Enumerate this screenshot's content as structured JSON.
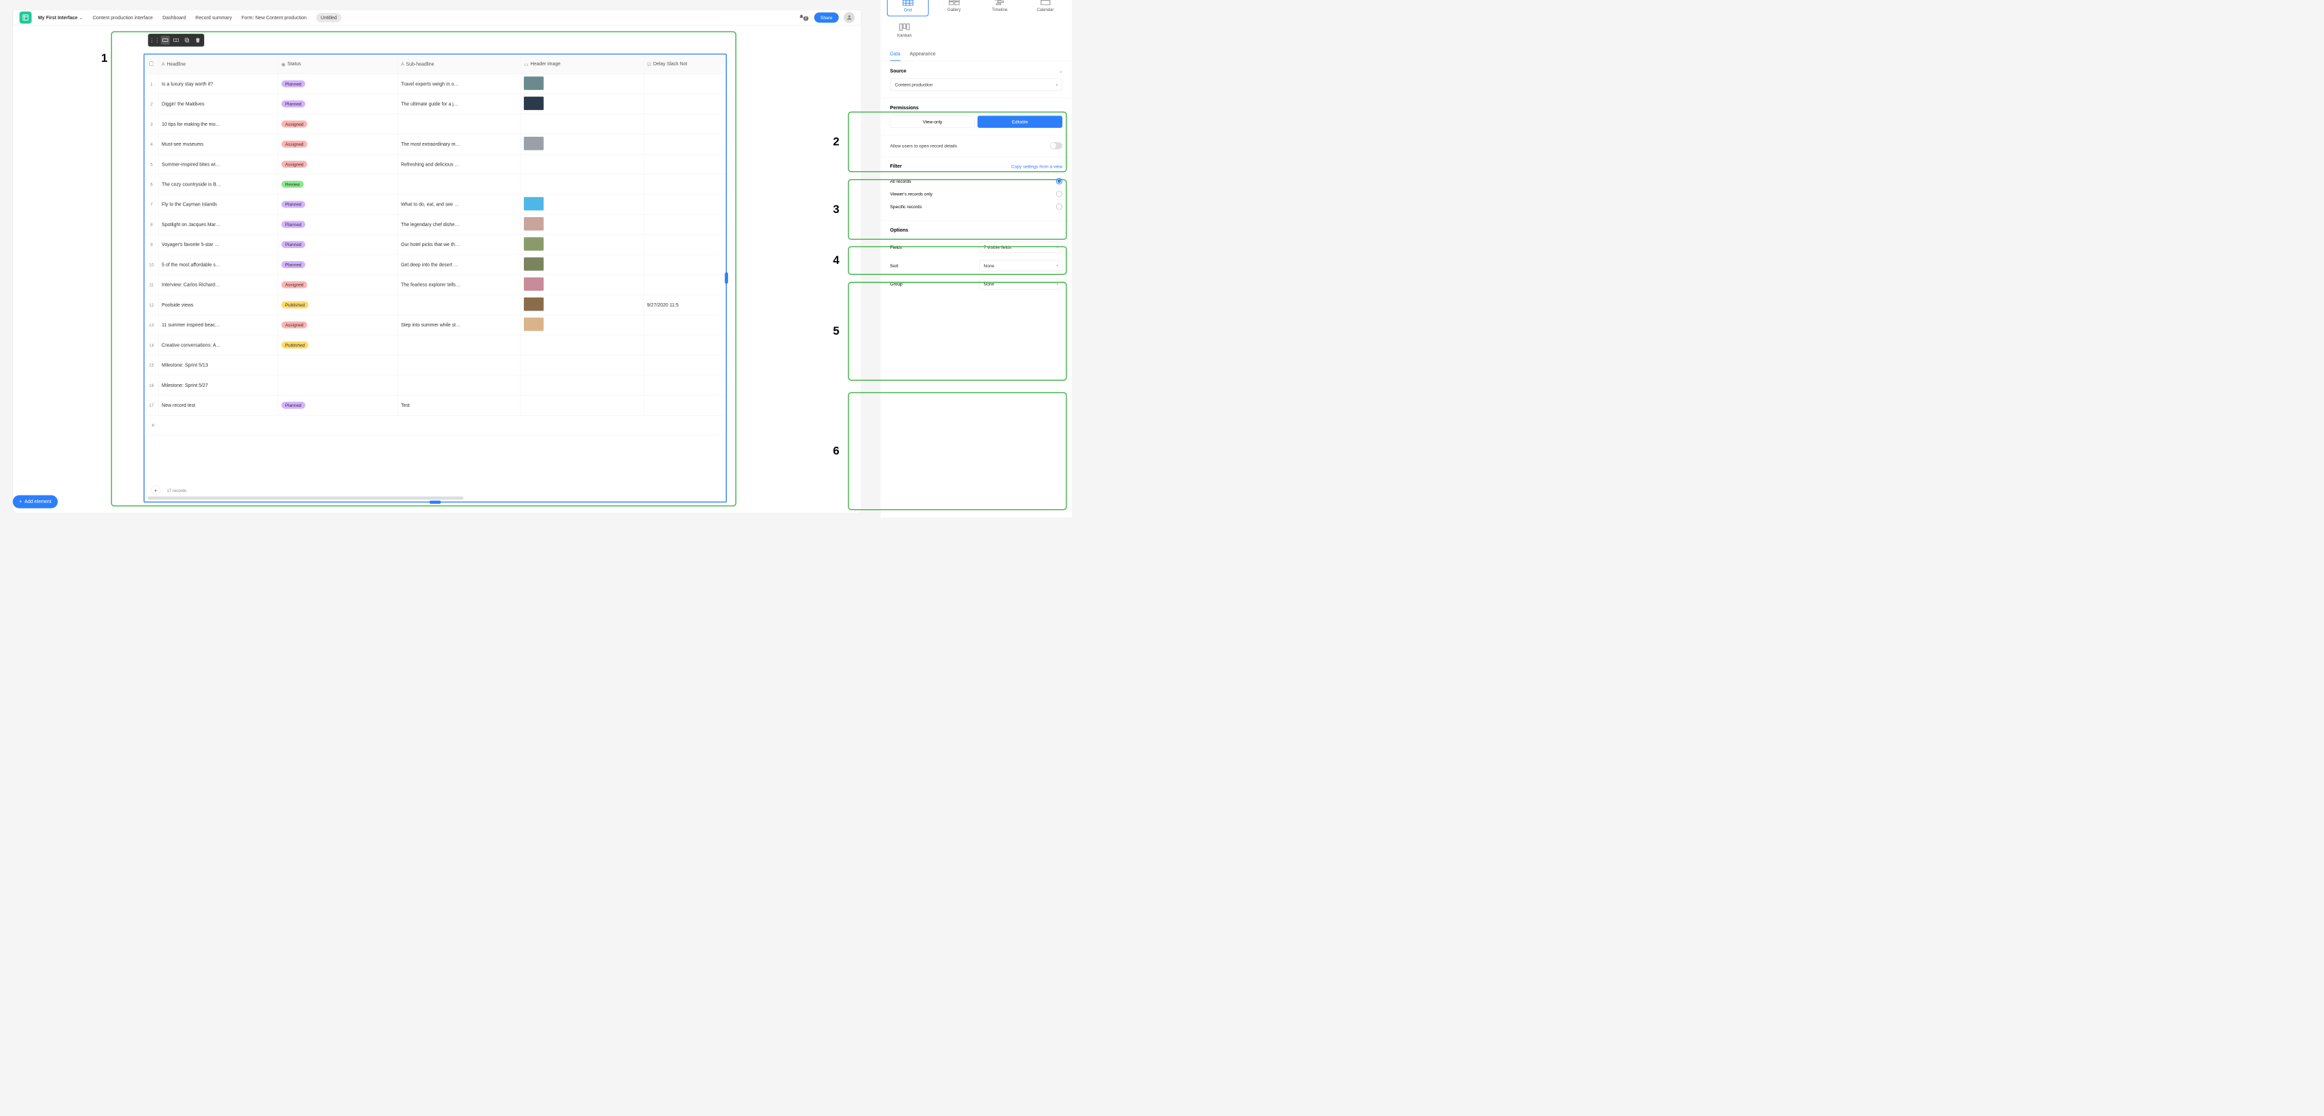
{
  "header": {
    "interface_name": "My First Interface",
    "tabs": [
      "Content production interface",
      "Dashboard",
      "Record summary",
      "Form: New Content production",
      "Untitled"
    ],
    "active_tab_index": 4,
    "notif_count": "8",
    "share_label": "Share"
  },
  "toolbar_callout": "1",
  "grid": {
    "columns": [
      "Headline",
      "Status",
      "Sub-headline",
      "Header image",
      "Delay Slack Not"
    ],
    "rows": [
      {
        "n": "1",
        "headline": "Is a luxury stay worth it?",
        "status": "Planned",
        "sub": "Travel experts weigh in o…",
        "img": "#6b8a8e",
        "delay": ""
      },
      {
        "n": "2",
        "headline": "Diggin' the Maldives",
        "status": "Planned",
        "sub": "The ultimate guide for a j…",
        "img": "#2b3a4a",
        "delay": ""
      },
      {
        "n": "3",
        "headline": "10 tips for making the mo…",
        "status": "Assigned",
        "sub": "",
        "img": "",
        "delay": ""
      },
      {
        "n": "4",
        "headline": "Must-see museums",
        "status": "Assigned",
        "sub": "The most extraordinary m…",
        "img": "#9aa0a6",
        "delay": ""
      },
      {
        "n": "5",
        "headline": "Summer-inspired bites wi…",
        "status": "Assigned",
        "sub": "Refreshing and delicious …",
        "img": "",
        "delay": ""
      },
      {
        "n": "6",
        "headline": "The cozy countryside is B…",
        "status": "Review",
        "sub": "",
        "img": "",
        "delay": ""
      },
      {
        "n": "7",
        "headline": "Fly to the Cayman Islands",
        "status": "Planned",
        "sub": "What to do, eat, and see …",
        "img": "#4db8e8",
        "delay": ""
      },
      {
        "n": "8",
        "headline": "Spotlight on Jacques Mar…",
        "status": "Planned",
        "sub": "The legendary chef dishe…",
        "img": "#c9a49a",
        "delay": ""
      },
      {
        "n": "9",
        "headline": "Voyager's favorite 5-star …",
        "status": "Planned",
        "sub": "Our hotel picks that we th…",
        "img": "#8a9a6b",
        "delay": ""
      },
      {
        "n": "10",
        "headline": "5 of the most affordable s…",
        "status": "Planned",
        "sub": "Get deep into the desert …",
        "img": "#7a8560",
        "delay": ""
      },
      {
        "n": "11",
        "headline": "Interview: Carlos Richard…",
        "status": "Assigned",
        "sub": "The fearless explorer tells…",
        "img": "#c98a9a",
        "delay": ""
      },
      {
        "n": "12",
        "headline": "Poolside views",
        "status": "Published",
        "sub": "",
        "img": "#8a6b4a",
        "delay": "9/27/2020        11:5"
      },
      {
        "n": "13",
        "headline": "11 summer inspired beac…",
        "status": "Assigned",
        "sub": "Step into summer while st…",
        "img": "#d9b38a",
        "delay": ""
      },
      {
        "n": "14",
        "headline": "Creative conversations: A…",
        "status": "Published",
        "sub": "",
        "img": "",
        "delay": ""
      },
      {
        "n": "15",
        "headline": "Milestone: Sprint 5/13",
        "status": "",
        "sub": "",
        "img": "",
        "delay": ""
      },
      {
        "n": "16",
        "headline": "Milestone: Sprint 5/27",
        "status": "",
        "sub": "",
        "img": "",
        "delay": ""
      },
      {
        "n": "17",
        "headline": "New record test",
        "status": "Planned",
        "sub": "Test",
        "img": "",
        "delay": ""
      }
    ],
    "record_count": "17 records"
  },
  "rpanel": {
    "layouts": [
      "Grid",
      "Gallery",
      "Timeline",
      "Calendar",
      "Kanban"
    ],
    "selected_layout": 0,
    "tabs": [
      "Data",
      "Appearance"
    ],
    "active_tab": 0,
    "source": {
      "title": "Source",
      "value": "Content production",
      "callout": "2"
    },
    "permissions": {
      "title": "Permissions",
      "viewonly": "View-only",
      "editable": "Editable",
      "callout": "3"
    },
    "allow_open": {
      "label": "Allow users to open record details",
      "callout": "4"
    },
    "filter": {
      "title": "Filter",
      "copy_link": "Copy settings from a view",
      "options": [
        "All records",
        "Viewer's records only",
        "Specific records"
      ],
      "selected": 0,
      "callout": "5"
    },
    "options": {
      "title": "Options",
      "fields_label": "Fields",
      "fields_value": "7 visible fields",
      "sort_label": "Sort",
      "sort_value": "None",
      "group_label": "Group",
      "group_value": "None",
      "callout": "6"
    }
  },
  "add_element_label": "Add element"
}
